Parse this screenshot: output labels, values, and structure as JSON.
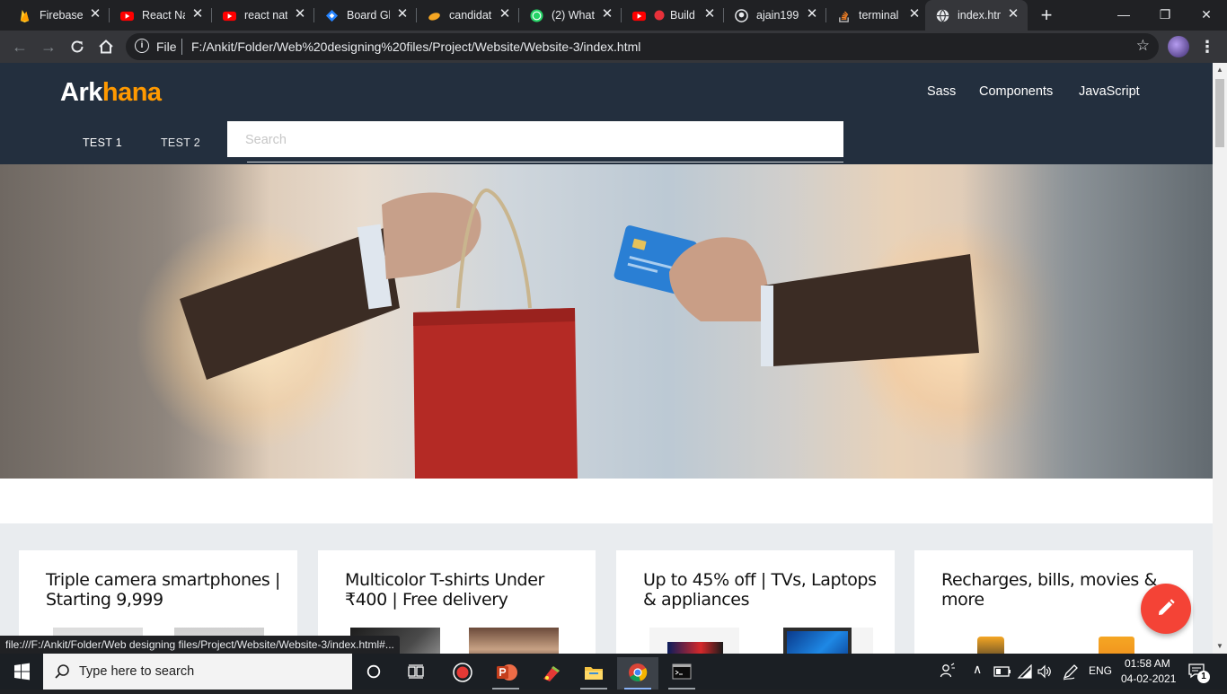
{
  "browser": {
    "tabs": [
      {
        "label": "Firebase",
        "icon": "firebase-icon",
        "color": "#ffca28"
      },
      {
        "label": "React Na",
        "icon": "youtube-icon",
        "color": "#ff0000"
      },
      {
        "label": "react nati",
        "icon": "youtube-icon",
        "color": "#ff0000"
      },
      {
        "label": "Board Gl",
        "icon": "jira-icon",
        "color": "#2684ff"
      },
      {
        "label": "candidat",
        "icon": "hackerearth-icon",
        "color": "#f5a623"
      },
      {
        "label": "(2) What",
        "icon": "whatsapp-icon",
        "color": "#25d366",
        "badge": "2"
      },
      {
        "label": "Build",
        "icon": "youtube-icon",
        "color": "#ff0000"
      },
      {
        "label": "ajain199",
        "icon": "github-icon",
        "color": "#e8eaed"
      },
      {
        "label": "terminal",
        "icon": "stackoverflow-icon",
        "color": "#f48024"
      },
      {
        "label": "index.htm",
        "icon": "globe-icon",
        "color": "#e8eaed",
        "active": true
      }
    ],
    "omnibox": {
      "scheme_label": "File",
      "url": "F:/Ankit/Folder/Web%20designing%20files/Project/Website/Website-3/index.html"
    },
    "status_url": "file:///F:/Ankit/Folder/Web designing files/Project/Website/Website-3/index.html#..."
  },
  "site": {
    "brand_part1": "Ark",
    "brand_part2": "hana",
    "brand_color": "#ff9900",
    "nav_color": "#232f3e",
    "top_links": [
      "Sass",
      "Components",
      "JavaScript"
    ],
    "sub_tabs": [
      "TEST 1",
      "TEST 2"
    ],
    "search_placeholder": "Search",
    "cards": [
      {
        "title": "Triple camera smartphones | Starting 9,999"
      },
      {
        "title": "Multicolor T-shirts Under ₹400 | Free delivery"
      },
      {
        "title": "Up to 45% off | TVs, Laptops & appliances"
      },
      {
        "title": "Recharges, bills, movies & more"
      }
    ],
    "fab_color": "#f44336",
    "fab_icon": "pencil-icon"
  },
  "taskbar": {
    "search_placeholder": "Type here to search",
    "apps": [
      "cortana-icon",
      "task-view-icon",
      "screen-recorder-icon",
      "powerpoint-icon",
      "paint-icon",
      "file-explorer-icon",
      "chrome-icon",
      "terminal-icon"
    ],
    "language": "ENG",
    "time": "01:58 AM",
    "date": "04-02-2021",
    "notification_count": "1"
  }
}
